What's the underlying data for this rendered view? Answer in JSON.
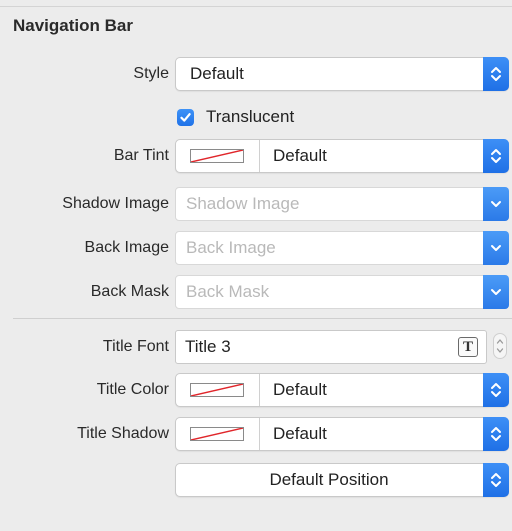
{
  "section": {
    "title": "Navigation Bar"
  },
  "style": {
    "label": "Style",
    "value": "Default"
  },
  "translucent": {
    "label": "Translucent",
    "checked": true
  },
  "bar_tint": {
    "label": "Bar Tint",
    "value": "Default"
  },
  "shadow_image": {
    "label": "Shadow Image",
    "placeholder": "Shadow Image"
  },
  "back_image": {
    "label": "Back Image",
    "placeholder": "Back Image"
  },
  "back_mask": {
    "label": "Back Mask",
    "placeholder": "Back Mask"
  },
  "title_font": {
    "label": "Title Font",
    "value": "Title 3",
    "icon": "font-picker-icon"
  },
  "title_color": {
    "label": "Title Color",
    "value": "Default"
  },
  "title_shadow": {
    "label": "Title Shadow",
    "value": "Default"
  },
  "shadow_offset": {
    "value": "Default Position"
  },
  "colors": {
    "accent": "#1f72e8",
    "background": "#ececec",
    "swatch_slash": "#e0262b"
  }
}
